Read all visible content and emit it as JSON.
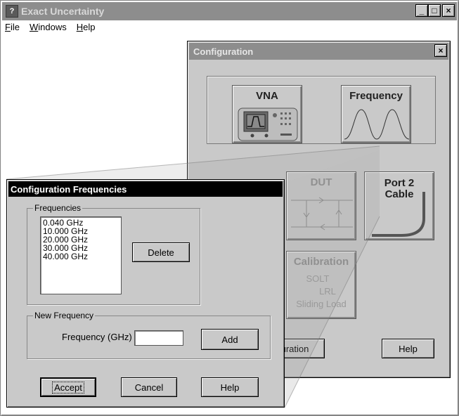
{
  "app": {
    "title": "Exact Uncertainty",
    "icon_glyph": "?",
    "menu": [
      {
        "label": "File",
        "accel": "F",
        "rest": "ile"
      },
      {
        "label": "Windows",
        "accel": "W",
        "rest": "indows"
      },
      {
        "label": "Help",
        "accel": "H",
        "rest": "elp"
      }
    ],
    "caption": {
      "minimize": "_",
      "maximize": "□",
      "close": "×"
    }
  },
  "configuration": {
    "title": "Configuration",
    "close": "×",
    "tiles": {
      "vna": "VNA",
      "frequency": "Frequency",
      "dut": "DUT",
      "port2_cable_line1": "Port 2",
      "port2_cable_line2": "Cable",
      "calibration": "Calibration",
      "cal_solt": "SOLT",
      "cal_lrl": "LRL",
      "cal_sliding_load": "Sliding Load"
    },
    "partial_button": "uration",
    "help_button": "Help"
  },
  "frequencies_dialog": {
    "title": "Configuration Frequencies",
    "frequencies_group": "Frequencies",
    "frequency_list": [
      "0.040 GHz",
      "10.000 GHz",
      "20.000 GHz",
      "30.000 GHz",
      "40.000 GHz"
    ],
    "delete_button": "Delete",
    "new_frequency_group": "New Frequency",
    "frequency_label": "Frequency (GHz)",
    "frequency_input_value": "",
    "add_button": "Add",
    "accept_button": "Accept",
    "cancel_button": "Cancel",
    "help_button": "Help"
  },
  "colors": {
    "title_active": "#000000",
    "title_inactive": "#8d8d8d",
    "face": "#c9c9c9"
  }
}
